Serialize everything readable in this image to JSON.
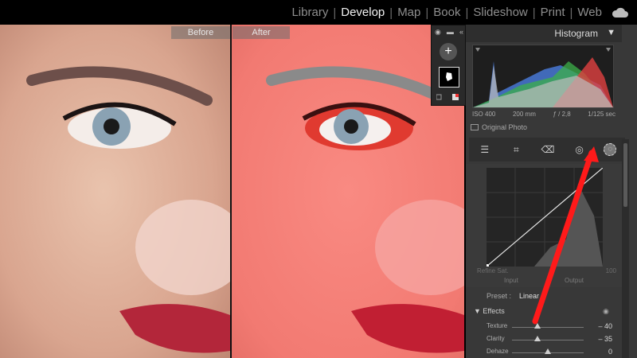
{
  "modules": [
    {
      "label": "Library",
      "active": false
    },
    {
      "label": "Develop",
      "active": true
    },
    {
      "label": "Map",
      "active": false
    },
    {
      "label": "Book",
      "active": false
    },
    {
      "label": "Slideshow",
      "active": false
    },
    {
      "label": "Print",
      "active": false
    },
    {
      "label": "Web",
      "active": false
    }
  ],
  "view": {
    "before_label": "Before",
    "after_label": "After"
  },
  "histogram": {
    "title": "Histogram",
    "iso": "ISO 400",
    "focal": "200 mm",
    "aperture": "ƒ / 2,8",
    "shutter": "1/125 sec",
    "original_photo_label": "Original Photo"
  },
  "curve": {
    "refine_label": "Refine Sat.",
    "refine_value": "100",
    "input_label": "Input",
    "output_label": "Output"
  },
  "preset": {
    "label": "Preset :",
    "value": "Linear"
  },
  "effects": {
    "title": "Effects",
    "sliders": [
      {
        "label": "Texture",
        "value": "– 40",
        "position": 0.35
      },
      {
        "label": "Clarity",
        "value": "– 35",
        "position": 0.36
      },
      {
        "label": "Dehaze",
        "value": "0",
        "position": 0.5
      }
    ]
  },
  "annotation": {
    "color": "#ff1a1a"
  }
}
